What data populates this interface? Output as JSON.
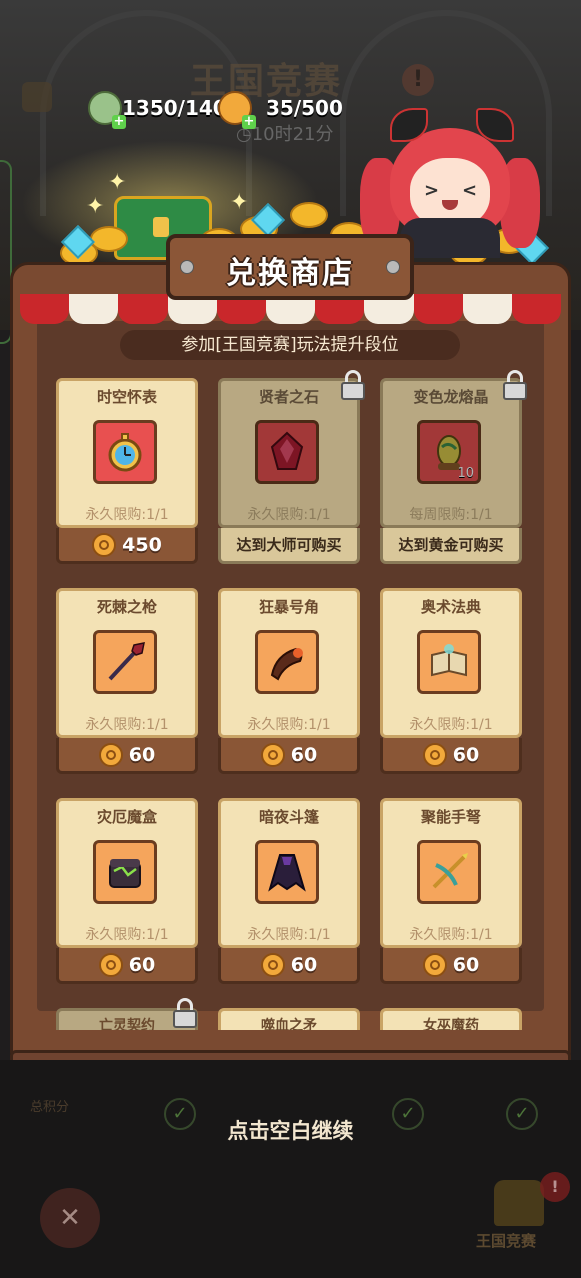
{
  "background": {
    "event_title": "王国竞赛",
    "timer": "◷10时21分",
    "score_label": "总积分",
    "trophy_label": "王国竞赛"
  },
  "currency": {
    "primary": {
      "value": "1350/1400",
      "icon": "potion-coin-icon"
    },
    "secondary": {
      "value": "35/500",
      "icon": "arena-coin-icon"
    }
  },
  "shop": {
    "title": "兑换商店",
    "subtitle": "参加[王国竞赛]玩法提升段位",
    "cards": [
      {
        "name": "时空怀表",
        "limit": "永久限购:1/1",
        "price": "450",
        "locked": false,
        "icon": "pocket-watch-icon"
      },
      {
        "name": "贤者之石",
        "limit": "永久限购:1/1",
        "unlock": "达到大师可购买",
        "locked": true,
        "icon": "red-crystal-icon"
      },
      {
        "name": "变色龙熔晶",
        "limit": "每周限购:1/1",
        "unlock": "达到黄金可购买",
        "locked": true,
        "icon": "dragon-egg-icon",
        "qty": "10"
      },
      {
        "name": "死棘之枪",
        "limit": "永久限购:1/1",
        "price": "60",
        "locked": false,
        "icon": "spear-icon"
      },
      {
        "name": "狂暴号角",
        "limit": "永久限购:1/1",
        "price": "60",
        "locked": false,
        "icon": "horn-icon"
      },
      {
        "name": "奥术法典",
        "limit": "永久限购:1/1",
        "price": "60",
        "locked": false,
        "icon": "spellbook-icon"
      },
      {
        "name": "灾厄魔盒",
        "limit": "永久限购:1/1",
        "price": "60",
        "locked": false,
        "icon": "cursed-box-icon"
      },
      {
        "name": "暗夜斗篷",
        "limit": "永久限购:1/1",
        "price": "60",
        "locked": false,
        "icon": "cloak-icon"
      },
      {
        "name": "聚能手弩",
        "limit": "永久限购:1/1",
        "price": "60",
        "locked": false,
        "icon": "crossbow-icon"
      }
    ],
    "peek_cards": [
      {
        "name": "亡灵契约",
        "locked": true
      },
      {
        "name": "噬血之矛",
        "locked": false
      },
      {
        "name": "女巫魔药",
        "locked": false
      }
    ]
  },
  "continue_text": "点击空白继续",
  "colors": {
    "accent_red": "#c9272b",
    "wood": "#7a4a31",
    "paper": "#f3e2b5",
    "gold": "#f2a93b"
  }
}
